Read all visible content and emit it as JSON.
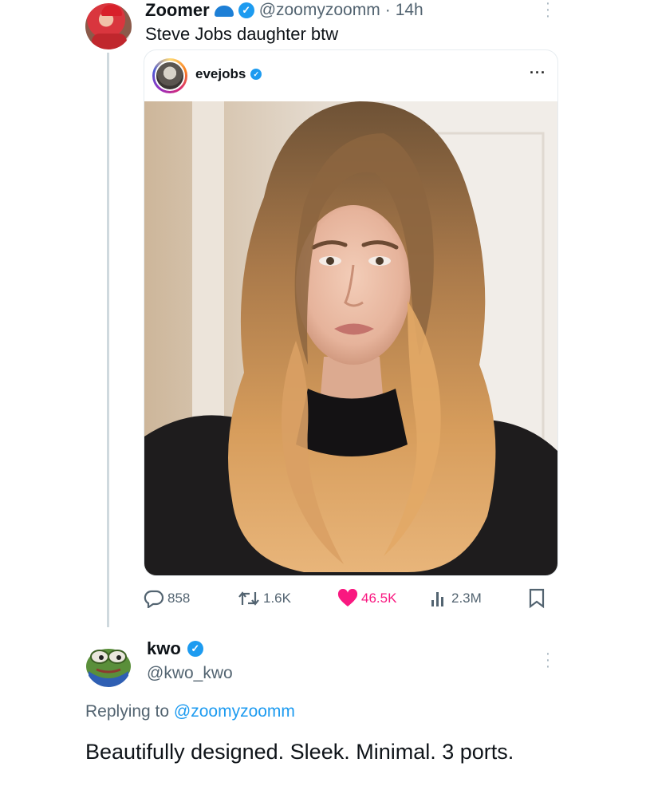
{
  "tweet": {
    "author_name": "Zoomer",
    "handle": "@zoomyzoomm",
    "separator": "·",
    "time": "14h",
    "text": "Steve Jobs daughter btw",
    "more_icon": "more-vertical-icon"
  },
  "embed": {
    "username": "evejobs",
    "more_icon": "more-horizontal-icon",
    "verified": true
  },
  "actions": {
    "replies": "858",
    "retweets": "1.6K",
    "likes": "46.5K",
    "views": "2.3M",
    "like_color": "#f91880"
  },
  "reply": {
    "author_name": "kwo",
    "handle": "@kwo_kwo",
    "replying_prefix": "Replying to",
    "replying_to": "@zoomyzoomm",
    "text": "Beautifully designed. Sleek. Minimal. 3 ports."
  },
  "colors": {
    "accent": "#1d9bf0",
    "muted": "#536471",
    "text": "#0f1419"
  }
}
